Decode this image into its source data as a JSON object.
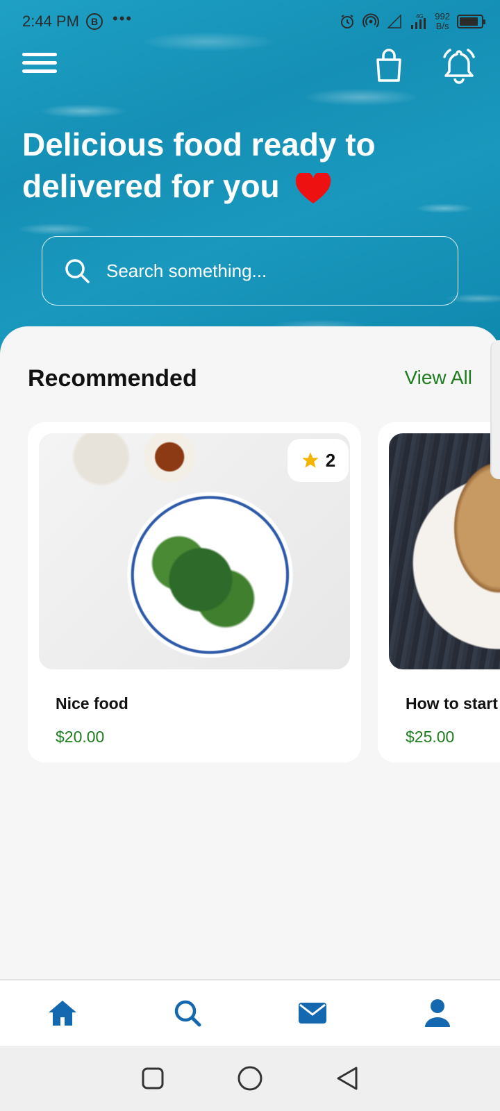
{
  "status_bar": {
    "time": "2:44 PM",
    "b_badge": "B",
    "dots": "•••",
    "net_speed_value": "992",
    "net_speed_unit": "B/s",
    "network": "4G",
    "battery_level": 0.85
  },
  "header": {
    "menu_icon": "hamburger-menu-icon",
    "cart_icon": "shopping-bag-icon",
    "notification_icon": "bell-icon",
    "title_line1": "Delicious food ready to",
    "title_line2": "delivered for you",
    "heart_color": "#ee1111"
  },
  "search": {
    "placeholder": "Search something..."
  },
  "recommended": {
    "title": "Recommended",
    "view_all": "View All",
    "items": [
      {
        "name": "Nice food",
        "price": "$20.00",
        "rating": "2",
        "image": "salad-plate"
      },
      {
        "name": "How to start",
        "price": "$25.00",
        "image": "roast-chicken"
      }
    ]
  },
  "bottom_nav": {
    "items": [
      {
        "icon": "home-icon",
        "active": true
      },
      {
        "icon": "search-icon"
      },
      {
        "icon": "mail-icon"
      },
      {
        "icon": "profile-icon"
      }
    ],
    "color": "#1468b0"
  },
  "colors": {
    "accent_green": "#1e7d1e",
    "nav_blue": "#1468b0",
    "hero_blue": "#158fb5"
  }
}
